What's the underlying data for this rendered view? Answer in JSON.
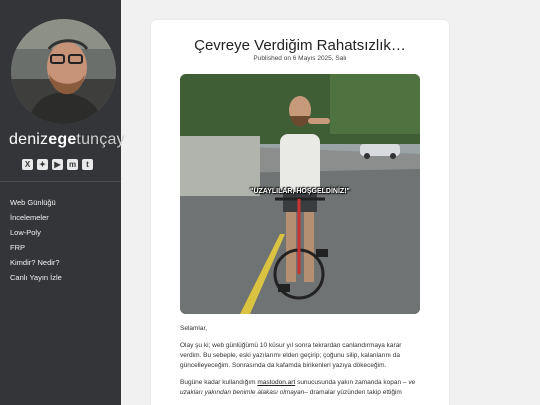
{
  "sidebar": {
    "brand": {
      "part1": "deniz",
      "part2": "ege",
      "part3": "tunçay"
    },
    "socials": [
      {
        "icon": "x-icon",
        "glyph": "X"
      },
      {
        "icon": "bluesky-icon",
        "glyph": "✦"
      },
      {
        "icon": "youtube-icon",
        "glyph": "▶"
      },
      {
        "icon": "mastodon-icon",
        "glyph": "m"
      },
      {
        "icon": "twitch-icon",
        "glyph": "t"
      }
    ],
    "nav": [
      "Web Günlüğü",
      "İncelemeler",
      "Low-Poly",
      "FRP",
      "Kimdir? Nedir?",
      "Canlı Yayın İzle"
    ]
  },
  "post": {
    "title": "Çevreye Verdiğim Rahatsızlık…",
    "date": "Published on 6 Mayıs 2025, Salı",
    "image_caption": "\"UZAYLILAR, HOŞGELDİNİZ!\"",
    "greeting": "Selamlar,",
    "para1": "Olay şu ki; web günlüğümü 10 küsur yıl sonra tekrardan canlandırmaya karar verdim. Bu sebeple, eski yazılarımı elden geçirip; çoğunu silip, kalanlarını da güncelleyeceğim. Sonrasında da kafamda birikenleri yazıya dökeceğim.",
    "para2_a": "Bugüne kadar kullandığım ",
    "para2_link": "mastodon.art",
    "para2_b": " sunucusunda yakın zamanda kopan – ",
    "para2_italic": "ve uzakları yakından benimle alakası olmayan",
    "para2_c": "– dramalar yüzünden takip ettiğim"
  },
  "colors": {
    "sidebar_bg": "#333538",
    "page_bg": "#f1f1f1",
    "card_bg": "#ffffff"
  }
}
